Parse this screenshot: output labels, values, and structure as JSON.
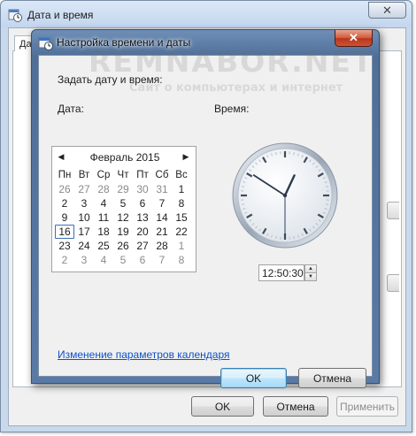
{
  "background_window": {
    "title": "Дата и время",
    "close_glyph": "✕",
    "tab_label": "Дат",
    "buttons": {
      "ok": "OK",
      "cancel": "Отмена",
      "apply": "Применить"
    }
  },
  "watermark": {
    "main": "REMNABOR.NET",
    "sub": "Сайт о компьютерах и интернет"
  },
  "dialog": {
    "title": "Настройка времени и даты",
    "close_glyph": "✕",
    "set_label": "Задать дату и время:",
    "date_label": "Дата:",
    "time_label": "Время:",
    "calendar": {
      "prev_glyph": "◀",
      "next_glyph": "▶",
      "month": "Февраль 2015",
      "weekdays": [
        "Пн",
        "Вт",
        "Ср",
        "Чт",
        "Пт",
        "Сб",
        "Вс"
      ],
      "weeks": [
        [
          "26",
          "27",
          "28",
          "29",
          "30",
          "31",
          "1"
        ],
        [
          "2",
          "3",
          "4",
          "5",
          "6",
          "7",
          "8"
        ],
        [
          "9",
          "10",
          "11",
          "12",
          "13",
          "14",
          "15"
        ],
        [
          "16",
          "17",
          "18",
          "19",
          "20",
          "21",
          "22"
        ],
        [
          "23",
          "24",
          "25",
          "26",
          "27",
          "28",
          "1"
        ],
        [
          "2",
          "3",
          "4",
          "5",
          "6",
          "7",
          "8"
        ]
      ],
      "selected_day": "16"
    },
    "clock": {
      "hours": 12,
      "minutes": 50,
      "seconds": 30
    },
    "time_value": "12:50:30",
    "calendar_settings_link": "Изменение параметров календаря",
    "buttons": {
      "ok": "OK",
      "cancel": "Отмена"
    }
  },
  "colors": {
    "accent_link": "#0d52c7",
    "close_red": "#c8472b",
    "focus_border": "#3b6fb1"
  }
}
